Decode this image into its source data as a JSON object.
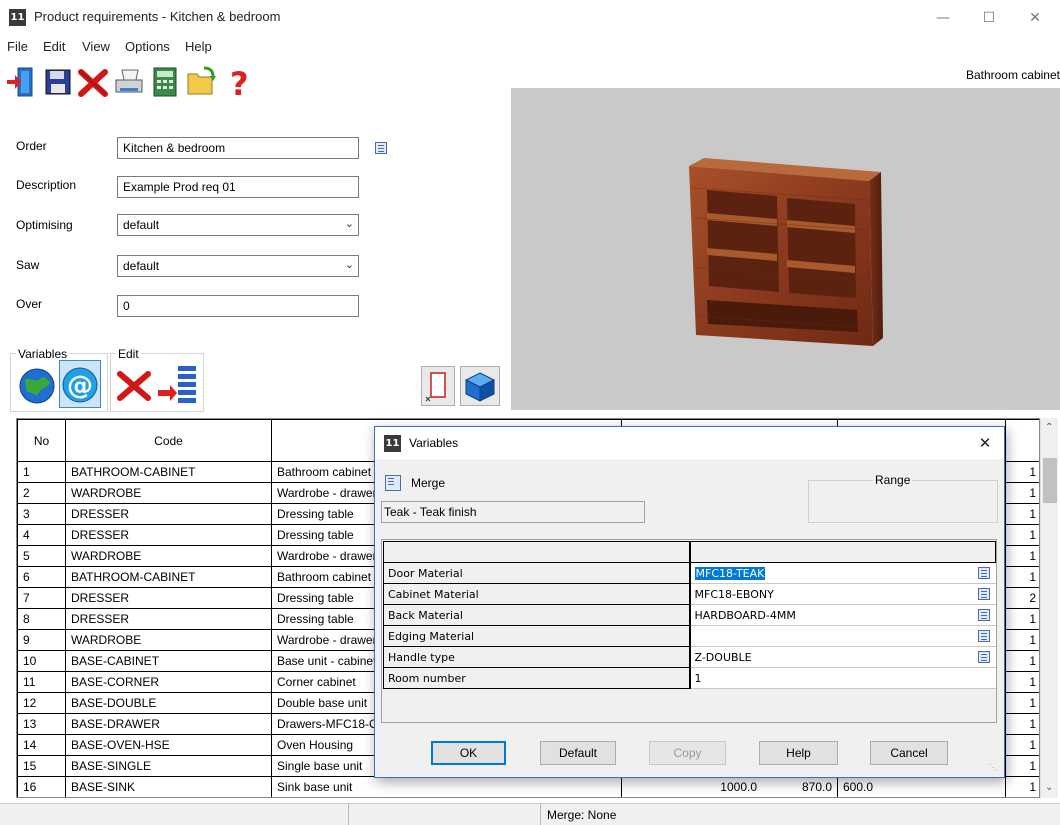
{
  "window": {
    "title": "Product requirements - Kitchen & bedroom",
    "app_logo": "11"
  },
  "menu": [
    "File",
    "Edit",
    "View",
    "Options",
    "Help"
  ],
  "toolbar": {
    "buttons": [
      {
        "icon": "exit-door-icon"
      },
      {
        "icon": "save-floppy-icon"
      },
      {
        "icon": "delete-x-icon"
      },
      {
        "icon": "printer-icon"
      },
      {
        "icon": "calculator-icon"
      },
      {
        "icon": "open-folder-icon"
      },
      {
        "icon": "help-question-icon"
      }
    ],
    "right_title": "Bathroom cabinet"
  },
  "form": {
    "order_label": "Order",
    "order_value": "Kitchen & bedroom",
    "description_label": "Description",
    "description_value": "Example Prod req 01",
    "optimising_label": "Optimising",
    "optimising_value": "default",
    "saw_label": "Saw",
    "saw_value": "default",
    "over_label": "Over",
    "over_value": "0"
  },
  "groups": {
    "variables_label": "Variables",
    "edit_label": "Edit"
  },
  "grid": {
    "headers": {
      "no": "No",
      "code": "Code"
    },
    "rows": [
      {
        "no": "1",
        "code": "BATHROOM-CABINET",
        "desc": "Bathroom cabinet",
        "qty": "1"
      },
      {
        "no": "2",
        "code": "WARDROBE",
        "desc": "Wardrobe - drawer",
        "qty": "1"
      },
      {
        "no": "3",
        "code": "DRESSER",
        "desc": "Dressing table",
        "qty": "1"
      },
      {
        "no": "4",
        "code": "DRESSER",
        "desc": "Dressing table",
        "qty": "1"
      },
      {
        "no": "5",
        "code": "WARDROBE",
        "desc": "Wardrobe - drawer",
        "qty": "1"
      },
      {
        "no": "6",
        "code": "BATHROOM-CABINET",
        "desc": "Bathroom cabinet",
        "qty": "1"
      },
      {
        "no": "7",
        "code": "DRESSER",
        "desc": "Dressing table",
        "qty": "2"
      },
      {
        "no": "8",
        "code": "DRESSER",
        "desc": "Dressing table",
        "qty": "1"
      },
      {
        "no": "9",
        "code": "WARDROBE",
        "desc": "Wardrobe - drawer",
        "qty": "1"
      },
      {
        "no": "10",
        "code": "BASE-CABINET",
        "desc": "Base unit - cabinet",
        "qty": "1"
      },
      {
        "no": "11",
        "code": "BASE-CORNER",
        "desc": "Corner cabinet",
        "qty": "1"
      },
      {
        "no": "12",
        "code": "BASE-DOUBLE",
        "desc": "Double base unit",
        "qty": "1"
      },
      {
        "no": "13",
        "code": "BASE-DRAWER",
        "desc": "Drawers-MFC18-OAK",
        "qty": "1"
      },
      {
        "no": "14",
        "code": "BASE-OVEN-HSE",
        "desc": "Oven Housing",
        "qty": "1"
      },
      {
        "no": "15",
        "code": "BASE-SINGLE",
        "desc": "Single base unit",
        "qty": "1"
      },
      {
        "no": "16",
        "code": "BASE-SINK",
        "desc": "Sink base unit",
        "length": "1000.0",
        "height": "870.0",
        "depth": "600.0",
        "qty": "1"
      }
    ]
  },
  "status": {
    "merge": "Merge: None"
  },
  "dialog": {
    "title": "Variables",
    "logo": "11",
    "merge_label": "Merge",
    "merge_value": "Teak - Teak finish",
    "range_label": "Range",
    "variables": [
      {
        "name": "Door Material",
        "value": "MFC18-TEAK",
        "selected": true,
        "has_list": true
      },
      {
        "name": "Cabinet Material",
        "value": "MFC18-EBONY",
        "has_list": true
      },
      {
        "name": "Back Material",
        "value": "HARDBOARD-4MM",
        "has_list": true
      },
      {
        "name": "Edging Material",
        "value": "",
        "has_list": true
      },
      {
        "name": "Handle type",
        "value": "Z-DOUBLE",
        "has_list": true
      },
      {
        "name": "Room number",
        "value": "1",
        "has_list": false
      }
    ],
    "buttons": {
      "ok": "OK",
      "default": "Default",
      "copy": "Copy",
      "help": "Help",
      "cancel": "Cancel"
    }
  },
  "colors": {
    "accent": "#0078d7",
    "viewport_bg": "#c9c9c9",
    "wood": "#8b3a1e"
  }
}
